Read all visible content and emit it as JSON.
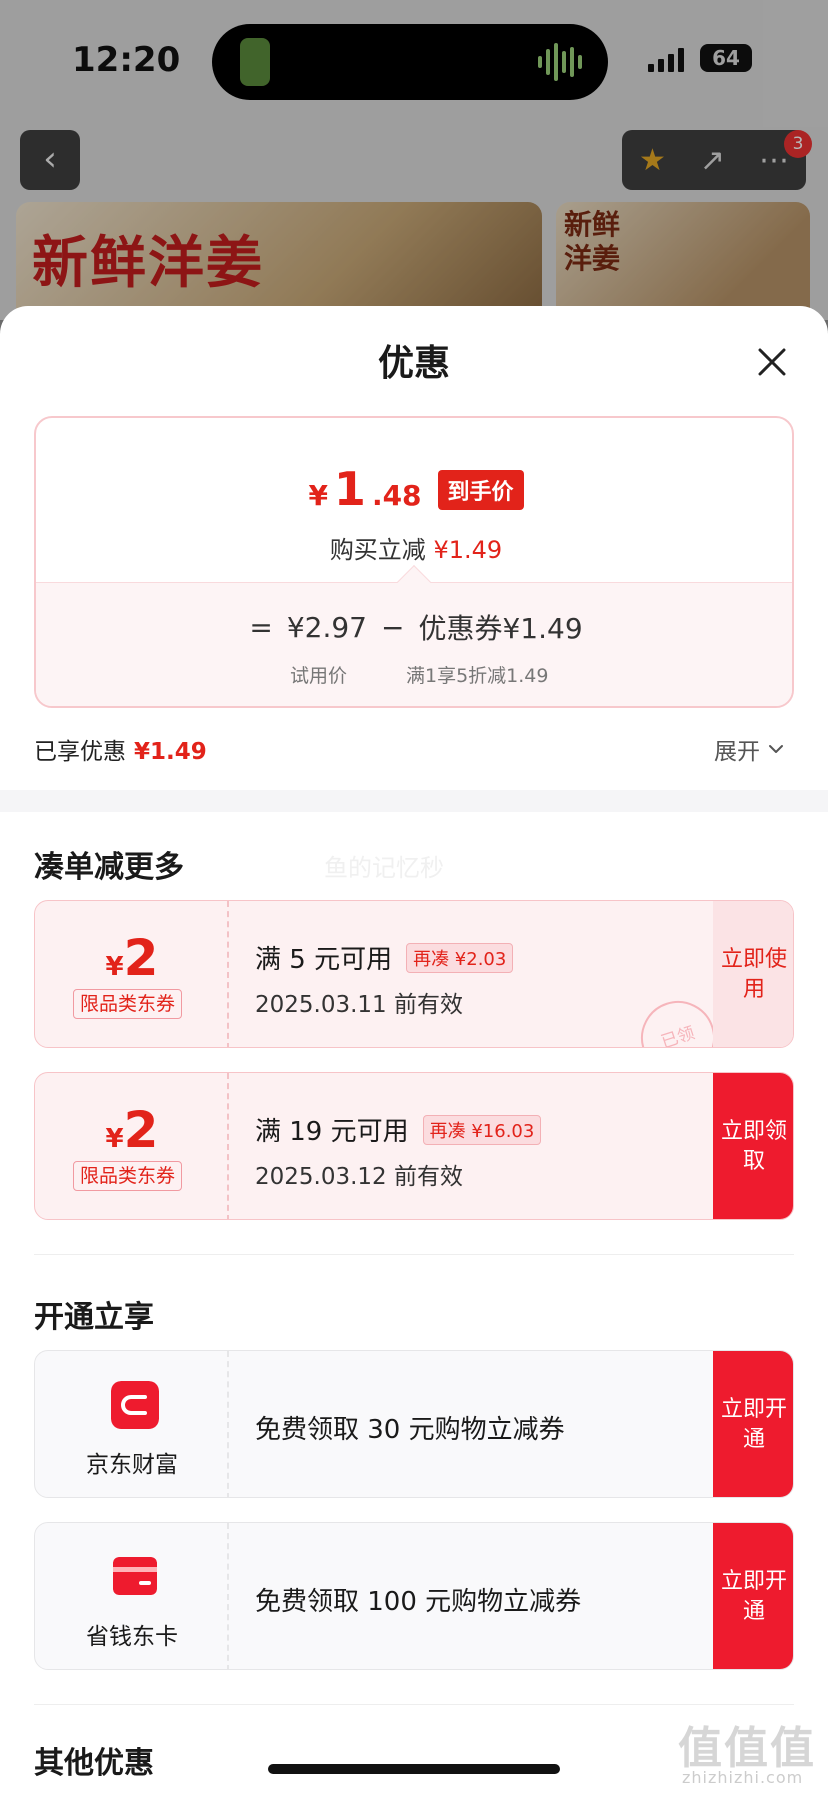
{
  "status_bar": {
    "time": "12:20",
    "battery": "64"
  },
  "background": {
    "banner_main_text": "新鲜洋姜",
    "banner_side_text": "新鲜洋姜",
    "more_badge": "3",
    "back_glyph": "‹",
    "share_glyph": "↗",
    "more_glyph": "⋯",
    "star_glyph": "★"
  },
  "sheet": {
    "title": "优惠",
    "final_price": {
      "currency": "¥",
      "integer": "1",
      "decimal": ".48",
      "tag": "到手价"
    },
    "instant_reduce": {
      "label": "购买立减",
      "amount": "¥1.49"
    },
    "equation": {
      "equals": "=",
      "trial_price": "¥2.97",
      "minus": "−",
      "coupon_label": "优惠券",
      "coupon_amount": "¥1.49",
      "trial_label": "试用价",
      "coupon_rule": "满1享5折减1.49"
    },
    "enjoyed": {
      "label": "已享优惠",
      "amount": "¥1.49"
    },
    "expand_label": "展开",
    "section_more": "凑单减更多",
    "watermark": "鱼的记忆秒",
    "coupons": [
      {
        "currency": "¥",
        "value": "2",
        "tag": "限品类东券",
        "condition": "满 5 元可用",
        "more": "再凑 ¥2.03",
        "valid": "2025.03.11 前有效",
        "action": "立即使用",
        "stamp": "已领"
      },
      {
        "currency": "¥",
        "value": "2",
        "tag": "限品类东券",
        "condition": "满 19 元可用",
        "more": "再凑 ¥16.03",
        "valid": "2025.03.12 前有效",
        "action": "立即领取"
      }
    ],
    "section_open": "开通立享",
    "services": [
      {
        "name": "京东财富",
        "desc": "免费领取 30 元购物立减券",
        "action": "立即开通"
      },
      {
        "name": "省钱东卡",
        "desc": "免费领取 100 元购物立减券",
        "action": "立即开通"
      }
    ],
    "section_other": "其他优惠"
  },
  "overlay": {
    "site_mark": "值值值",
    "site_domain": "zhizhizhi.com"
  },
  "colors": {
    "accent_red": "#e2231a",
    "button_red": "#ee1b2e",
    "coupon_bg": "#fdf1f2"
  }
}
